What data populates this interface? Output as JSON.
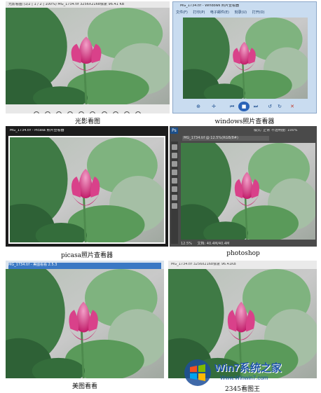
{
  "panels": [
    {
      "id": "p1",
      "caption": "光影看图",
      "title": "光影看图 (1/2 | 1 / 2 | 100%)  MG_1734.tif 3256X2168像素 96.41 KB"
    },
    {
      "id": "p2",
      "caption": "windows照片查看器",
      "title": "MG_1734.tif - Windows 照片查看器",
      "menu": [
        "文件(F)",
        "打印(P)",
        "电子邮件(E)",
        "刻录(U)",
        "打开(O)"
      ]
    },
    {
      "id": "p3",
      "caption": "picasa照片查看器",
      "title": "MG_1734.tif - Picasa 照片查看器"
    },
    {
      "id": "p4",
      "caption": "photoshop",
      "title": "MG_1734.tif @ 12.5%(RGB/8#)",
      "zoom": "12.5%",
      "doc_info": "文档: 40.4M/40.4M",
      "ps_logo": "Ps",
      "options": "模式: 正常   不透明度: 100%"
    },
    {
      "id": "p5",
      "caption": "美图看看",
      "title": "MG_1734.tif - 美图看看 2.5.3"
    },
    {
      "id": "p6",
      "caption": "2345看图王",
      "title": "MG_1734.tif 3256x2168像素 96.41KB"
    }
  ],
  "watermark": {
    "logo_text": "Win7系统之家",
    "url": "Www.Winwin7.com"
  },
  "colors": {
    "flower": "#d6337e",
    "leaf": "#5a9a5a",
    "bg": "#cfcfcf",
    "win_blue": "#2a63b8"
  }
}
